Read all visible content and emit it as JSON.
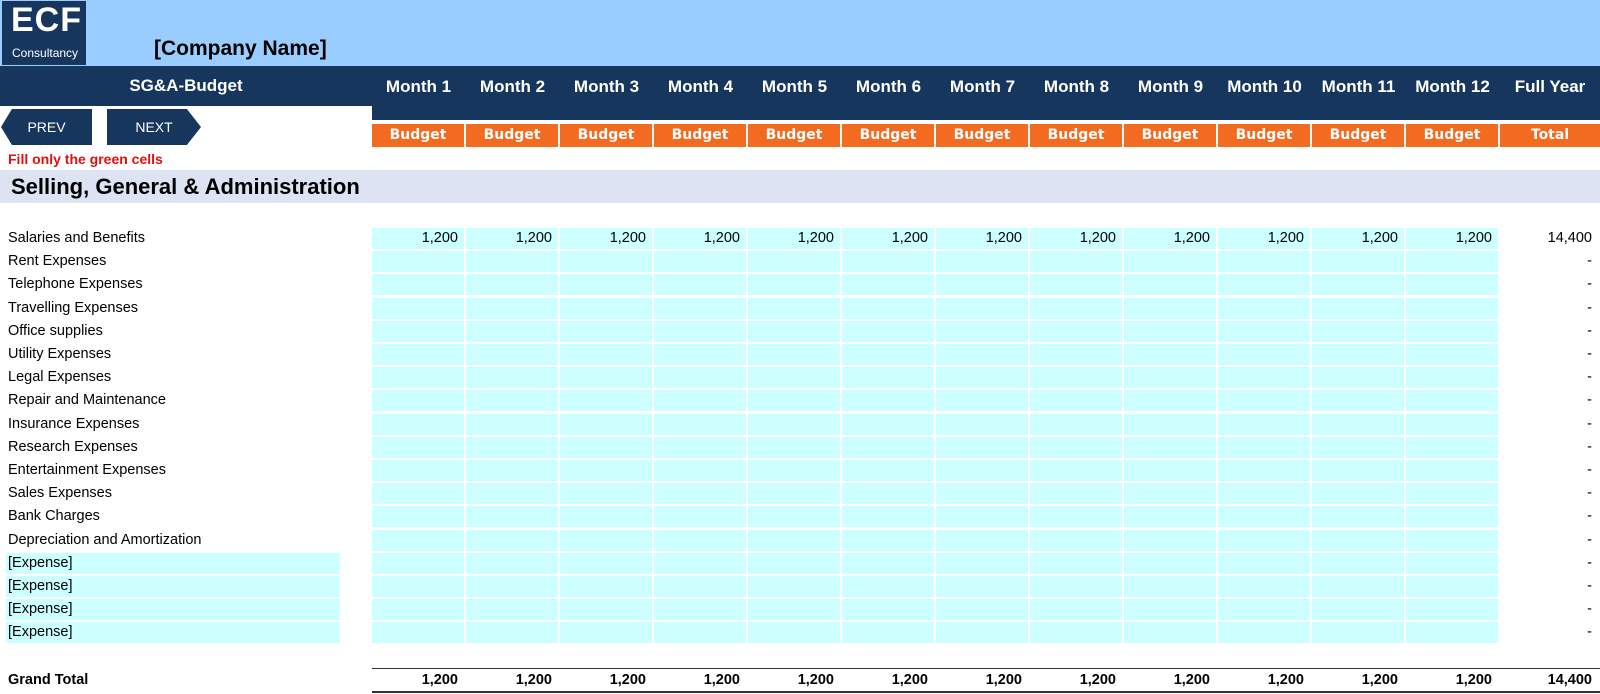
{
  "logo": {
    "main": "ECF",
    "sub": "Consultancy"
  },
  "company_name": "[Company Name]",
  "sheet_title": "SG&A-Budget",
  "nav": {
    "prev": "PREV",
    "next": "NEXT"
  },
  "instruction": "Fill only the green cells",
  "section_title": "Selling, General & Administration",
  "columns": [
    "Month 1",
    "Month 2",
    "Month 3",
    "Month 4",
    "Month 5",
    "Month 6",
    "Month 7",
    "Month 8",
    "Month 9",
    "Month 10",
    "Month 11",
    "Month 12",
    "Full Year"
  ],
  "column_subheaders": [
    "Budget",
    "Budget",
    "Budget",
    "Budget",
    "Budget",
    "Budget",
    "Budget",
    "Budget",
    "Budget",
    "Budget",
    "Budget",
    "Budget",
    "Total"
  ],
  "rows": [
    {
      "label": "Salaries and Benefits",
      "values": [
        "1,200",
        "1,200",
        "1,200",
        "1,200",
        "1,200",
        "1,200",
        "1,200",
        "1,200",
        "1,200",
        "1,200",
        "1,200",
        "1,200"
      ],
      "total": "14,400",
      "editable_label": false
    },
    {
      "label": "Rent Expenses",
      "values": [
        "",
        "",
        "",
        "",
        "",
        "",
        "",
        "",
        "",
        "",
        "",
        ""
      ],
      "total": "-",
      "editable_label": false
    },
    {
      "label": "Telephone Expenses",
      "values": [
        "",
        "",
        "",
        "",
        "",
        "",
        "",
        "",
        "",
        "",
        "",
        ""
      ],
      "total": "-",
      "editable_label": false
    },
    {
      "label": "Travelling Expenses",
      "values": [
        "",
        "",
        "",
        "",
        "",
        "",
        "",
        "",
        "",
        "",
        "",
        ""
      ],
      "total": "-",
      "editable_label": false
    },
    {
      "label": "Office supplies",
      "values": [
        "",
        "",
        "",
        "",
        "",
        "",
        "",
        "",
        "",
        "",
        "",
        ""
      ],
      "total": "-",
      "editable_label": false
    },
    {
      "label": "Utility Expenses",
      "values": [
        "",
        "",
        "",
        "",
        "",
        "",
        "",
        "",
        "",
        "",
        "",
        ""
      ],
      "total": "-",
      "editable_label": false
    },
    {
      "label": "Legal Expenses",
      "values": [
        "",
        "",
        "",
        "",
        "",
        "",
        "",
        "",
        "",
        "",
        "",
        ""
      ],
      "total": "-",
      "editable_label": false
    },
    {
      "label": "Repair and Maintenance",
      "values": [
        "",
        "",
        "",
        "",
        "",
        "",
        "",
        "",
        "",
        "",
        "",
        ""
      ],
      "total": "-",
      "editable_label": false
    },
    {
      "label": "Insurance Expenses",
      "values": [
        "",
        "",
        "",
        "",
        "",
        "",
        "",
        "",
        "",
        "",
        "",
        ""
      ],
      "total": "-",
      "editable_label": false
    },
    {
      "label": "Research Expenses",
      "values": [
        "",
        "",
        "",
        "",
        "",
        "",
        "",
        "",
        "",
        "",
        "",
        ""
      ],
      "total": "-",
      "editable_label": false
    },
    {
      "label": "Entertainment Expenses",
      "values": [
        "",
        "",
        "",
        "",
        "",
        "",
        "",
        "",
        "",
        "",
        "",
        ""
      ],
      "total": "-",
      "editable_label": false
    },
    {
      "label": "Sales Expenses",
      "values": [
        "",
        "",
        "",
        "",
        "",
        "",
        "",
        "",
        "",
        "",
        "",
        ""
      ],
      "total": "-",
      "editable_label": false
    },
    {
      "label": "Bank Charges",
      "values": [
        "",
        "",
        "",
        "",
        "",
        "",
        "",
        "",
        "",
        "",
        "",
        ""
      ],
      "total": "-",
      "editable_label": false
    },
    {
      "label": "Depreciation and Amortization",
      "values": [
        "",
        "",
        "",
        "",
        "",
        "",
        "",
        "",
        "",
        "",
        "",
        ""
      ],
      "total": "-",
      "editable_label": false
    },
    {
      "label": "[Expense]",
      "values": [
        "",
        "",
        "",
        "",
        "",
        "",
        "",
        "",
        "",
        "",
        "",
        ""
      ],
      "total": "-",
      "editable_label": true
    },
    {
      "label": "[Expense]",
      "values": [
        "",
        "",
        "",
        "",
        "",
        "",
        "",
        "",
        "",
        "",
        "",
        ""
      ],
      "total": "-",
      "editable_label": true
    },
    {
      "label": "[Expense]",
      "values": [
        "",
        "",
        "",
        "",
        "",
        "",
        "",
        "",
        "",
        "",
        "",
        ""
      ],
      "total": "-",
      "editable_label": true
    },
    {
      "label": "[Expense]",
      "values": [
        "",
        "",
        "",
        "",
        "",
        "",
        "",
        "",
        "",
        "",
        "",
        ""
      ],
      "total": "-",
      "editable_label": true
    }
  ],
  "grand_total": {
    "label": "Grand Total",
    "values": [
      "1,200",
      "1,200",
      "1,200",
      "1,200",
      "1,200",
      "1,200",
      "1,200",
      "1,200",
      "1,200",
      "1,200",
      "1,200",
      "1,200"
    ],
    "total": "14,400"
  },
  "colors": {
    "navy": "#17365d",
    "banner": "#99ccff",
    "orange": "#f26b21",
    "input_cell": "#ccffff",
    "section_band": "#dce3f2",
    "instruction": "#e01010"
  }
}
